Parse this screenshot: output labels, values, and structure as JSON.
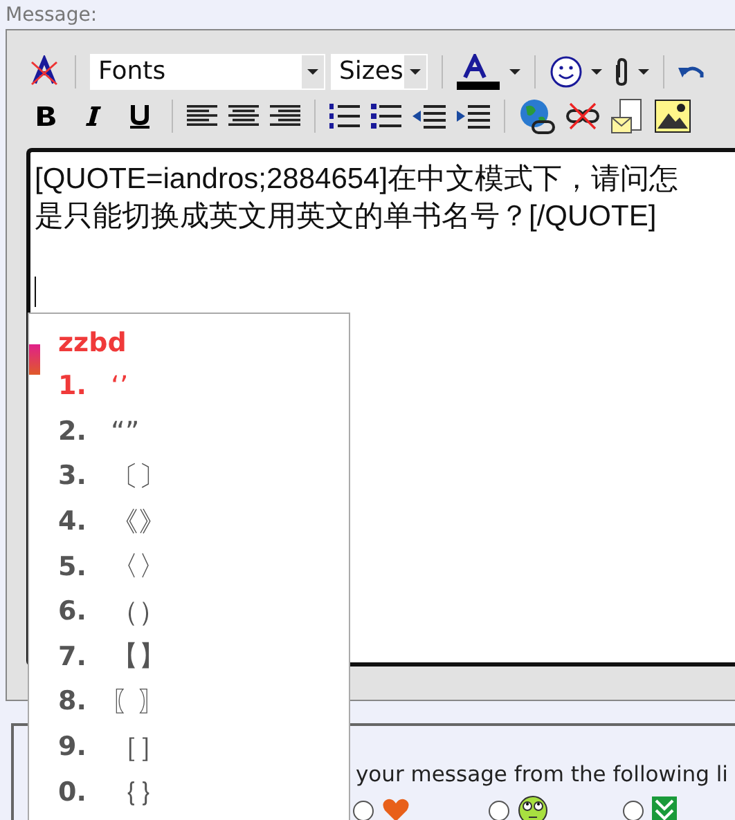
{
  "message_label": "Message:",
  "toolbar": {
    "font_select": "Fonts",
    "size_select": "Sizes"
  },
  "editor": {
    "lines": [
      "[QUOTE=iandros;2884654]在中文模式下，请问怎",
      "是只能切换成英文用英文的单书名号？[/QUOTE]"
    ]
  },
  "ime_popup": {
    "composition": "zzbd",
    "candidates": [
      {
        "number": "1.",
        "text": "‘’",
        "selected": true
      },
      {
        "number": "2.",
        "text": "“”",
        "selected": false
      },
      {
        "number": "3.",
        "text": "〔〕",
        "selected": false
      },
      {
        "number": "4.",
        "text": "《》",
        "selected": false
      },
      {
        "number": "5.",
        "text": "〈〉",
        "selected": false
      },
      {
        "number": "6.",
        "text": "（）",
        "selected": false
      },
      {
        "number": "7.",
        "text": "【】",
        "selected": false
      },
      {
        "number": "8.",
        "text": "〖〗",
        "selected": false
      },
      {
        "number": "9.",
        "text": "［］",
        "selected": false
      },
      {
        "number": "0.",
        "text": "｛｝",
        "selected": false
      }
    ]
  },
  "post_icons": {
    "hint": "your message from the following li",
    "options": [
      {
        "kind": "heart",
        "selected": false
      },
      {
        "kind": "face",
        "selected": false
      },
      {
        "kind": "check",
        "selected": false
      }
    ]
  }
}
